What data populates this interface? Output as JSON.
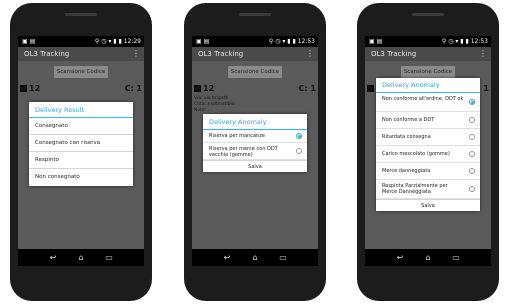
{
  "phones": [
    {
      "status": {
        "time": "12:29"
      },
      "app_title": "OL3 Tracking",
      "overflow_menu": "⋮",
      "scan_button": "Scansione Codice",
      "info": {
        "left": "12",
        "right": "C: 1"
      },
      "dialog": {
        "title": "Delivery Result",
        "options": [
          "Consegnato",
          "Consegnato con riserva",
          "Respinto",
          "Non consegnato"
        ]
      }
    },
    {
      "status": {
        "time": "12:53"
      },
      "app_title": "OL3 Tracking",
      "overflow_menu": "⋮",
      "scan_button": "Scansione Codice",
      "info": {
        "left": "12",
        "right": "C: 1"
      },
      "background_text": [
        "Via: via brigatti",
        "Citta: moltinatibia",
        "Note: ..."
      ],
      "dialog": {
        "title": "Delivery Anomaly",
        "options": [
          "Riserva per mancanze",
          "Riserva per merce con DDT vecchio (gomme)"
        ],
        "selected_index": 0,
        "save_label": "Salva"
      }
    },
    {
      "status": {
        "time": "12:53"
      },
      "app_title": "OL3 Tracking",
      "overflow_menu": "⋮",
      "scan_button": "Scansione Codice",
      "info": {
        "left": "12",
        "right": "C: 1"
      },
      "dialog": {
        "title": "Delivery Anomaly",
        "options": [
          "Non conforme all'ordine, DDT ok",
          "Non conforme a DDT",
          "Ritardata consegna",
          "Carico mescolato (gomme)",
          "Merce danneggiata",
          "Respinta Parzialmente per Merce Danneggiata"
        ],
        "selected_index": 0,
        "save_label": "Salva"
      }
    }
  ],
  "nav_icons": {
    "back": "back-arrow-icon",
    "home": "home-icon",
    "recent": "recent-apps-icon"
  },
  "colors": {
    "accent": "#33b5e5",
    "action_bar": "#4a4a4a",
    "screen_dim": "#5a5a5a",
    "phone_body": "#1c1c1c"
  }
}
